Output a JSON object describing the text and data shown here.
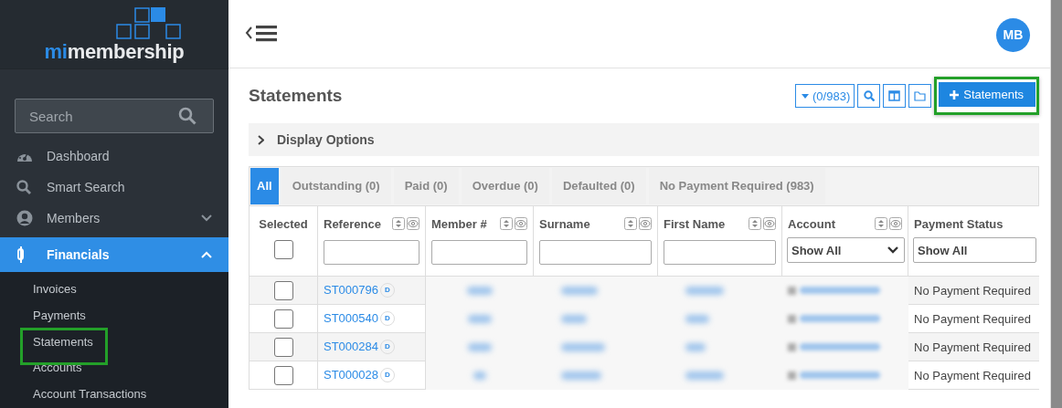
{
  "sidebar": {
    "logo": {
      "prefix": "mi",
      "rest": "membership"
    },
    "search": {
      "placeholder": "Search"
    },
    "items": [
      {
        "label": "Dashboard",
        "selected": false
      },
      {
        "label": "Smart Search",
        "selected": false
      },
      {
        "label": "Members",
        "selected": false,
        "expanded": false
      },
      {
        "label": "Financials",
        "selected": true,
        "expanded": true,
        "children": [
          {
            "label": "Invoices",
            "highlighted": false
          },
          {
            "label": "Payments",
            "highlighted": false
          },
          {
            "label": "Statements",
            "highlighted": true
          },
          {
            "label": "Accounts",
            "highlighted": false
          },
          {
            "label": "Account Transactions",
            "highlighted": false
          }
        ]
      }
    ]
  },
  "header": {
    "avatar": "MB"
  },
  "page": {
    "title": "Statements",
    "toolbar": [
      {
        "kind": "count",
        "label": "(0/983)"
      },
      {
        "kind": "search"
      },
      {
        "kind": "columns"
      },
      {
        "kind": "folder"
      },
      {
        "kind": "primary",
        "label": "Statements",
        "highlighted": true
      }
    ],
    "display_options": {
      "label": "Display Options",
      "expanded": false
    },
    "tabs": [
      {
        "label": "All",
        "selected": true
      },
      {
        "label": "Outstanding (0)",
        "selected": false
      },
      {
        "label": "Paid (0)",
        "selected": false
      },
      {
        "label": "Overdue (0)",
        "selected": false
      },
      {
        "label": "Defaulted (0)",
        "selected": false
      },
      {
        "label": "No Payment Required (983)",
        "selected": false
      }
    ],
    "table": {
      "columns": [
        {
          "label": "Selected",
          "kind": "checkbox",
          "checked": false,
          "tools": false
        },
        {
          "label": "Reference",
          "kind": "text",
          "tools": true
        },
        {
          "label": "Member #",
          "kind": "text",
          "tools": true
        },
        {
          "label": "Surname",
          "kind": "text",
          "tools": true
        },
        {
          "label": "First Name",
          "kind": "text",
          "tools": true
        },
        {
          "label": "Account",
          "kind": "select",
          "value": "Show All",
          "tools": true
        },
        {
          "label": "Payment Status",
          "kind": "select",
          "value": "Show All",
          "tools": false
        }
      ],
      "rows": [
        {
          "checked": false,
          "reference": "ST000796",
          "badge": "D",
          "blurred": true,
          "payment_status": "No Payment Required"
        },
        {
          "checked": false,
          "reference": "ST000540",
          "badge": "D",
          "blurred": true,
          "payment_status": "No Payment Required"
        },
        {
          "checked": false,
          "reference": "ST000284",
          "badge": "D",
          "blurred": true,
          "payment_status": "No Payment Required"
        },
        {
          "checked": false,
          "reference": "ST000028",
          "badge": "D",
          "blurred": true,
          "payment_status": "No Payment Required"
        }
      ]
    }
  }
}
